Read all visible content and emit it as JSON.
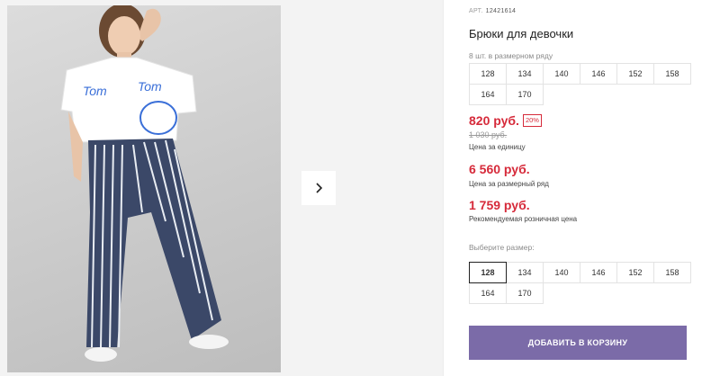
{
  "product": {
    "art_label": "АРТ.",
    "art_number": "12421614",
    "title": "Брюки для девочки"
  },
  "size_pack": {
    "label": "8 шт. в размерном ряду",
    "sizes": [
      "128",
      "134",
      "140",
      "146",
      "152",
      "158",
      "164",
      "170"
    ]
  },
  "prices": {
    "unit_price": "820 руб.",
    "discount": "20%",
    "old_price": "1 030 руб.",
    "unit_caption": "Цена за единицу",
    "pack_price": "6 560 руб.",
    "pack_caption": "Цена за размерный ряд",
    "retail_price": "1 759 руб.",
    "retail_caption": "Рекомендуемая розничная цена"
  },
  "size_select": {
    "label": "Выберите размер:",
    "sizes": [
      "128",
      "134",
      "140",
      "146",
      "152",
      "158",
      "164",
      "170"
    ],
    "selected": "128"
  },
  "actions": {
    "add_to_cart": "ДОБАВИТЬ В КОРЗИНУ"
  },
  "icons": {
    "next": "chevron-right-icon"
  },
  "colors": {
    "price": "#d62a3a",
    "button": "#7b6ba8"
  }
}
